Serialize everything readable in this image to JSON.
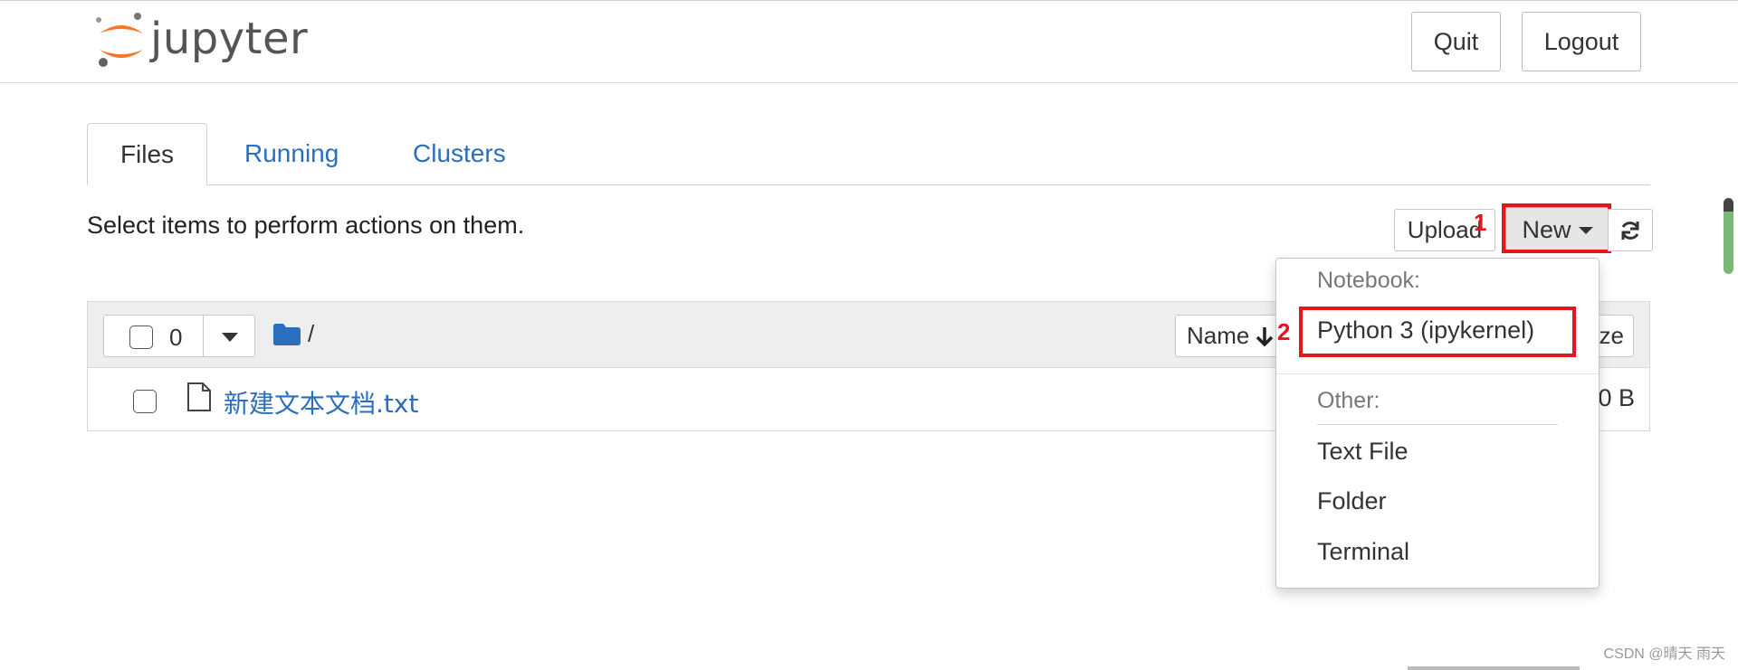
{
  "header": {
    "app_name": "jupyter",
    "quit_label": "Quit",
    "logout_label": "Logout"
  },
  "tabs": [
    {
      "label": "Files",
      "active": true
    },
    {
      "label": "Running",
      "active": false
    },
    {
      "label": "Clusters",
      "active": false
    }
  ],
  "toolbar": {
    "instructions": "Select items to perform actions on them.",
    "upload_label": "Upload",
    "new_label": "New",
    "refresh_icon": "refresh-icon"
  },
  "list_header": {
    "selected_count": "0",
    "path": "/",
    "name_sort_label": "Name",
    "size_sort_label_visible": "ze"
  },
  "files": [
    {
      "name": "新建文本文档.txt",
      "size": "0 B",
      "icon": "file-icon"
    }
  ],
  "new_menu": {
    "notebook_header": "Notebook:",
    "notebook_items": [
      "Python 3 (ipykernel)"
    ],
    "other_header": "Other:",
    "other_items": [
      "Text File",
      "Folder",
      "Terminal"
    ]
  },
  "annotations": {
    "marker_1": "1",
    "marker_2": "2",
    "highlight_color": "#e3171e"
  },
  "colors": {
    "link_blue": "#2a6ebd",
    "logo_orange": "#f37726"
  },
  "watermark": "CSDN @晴天 雨天"
}
